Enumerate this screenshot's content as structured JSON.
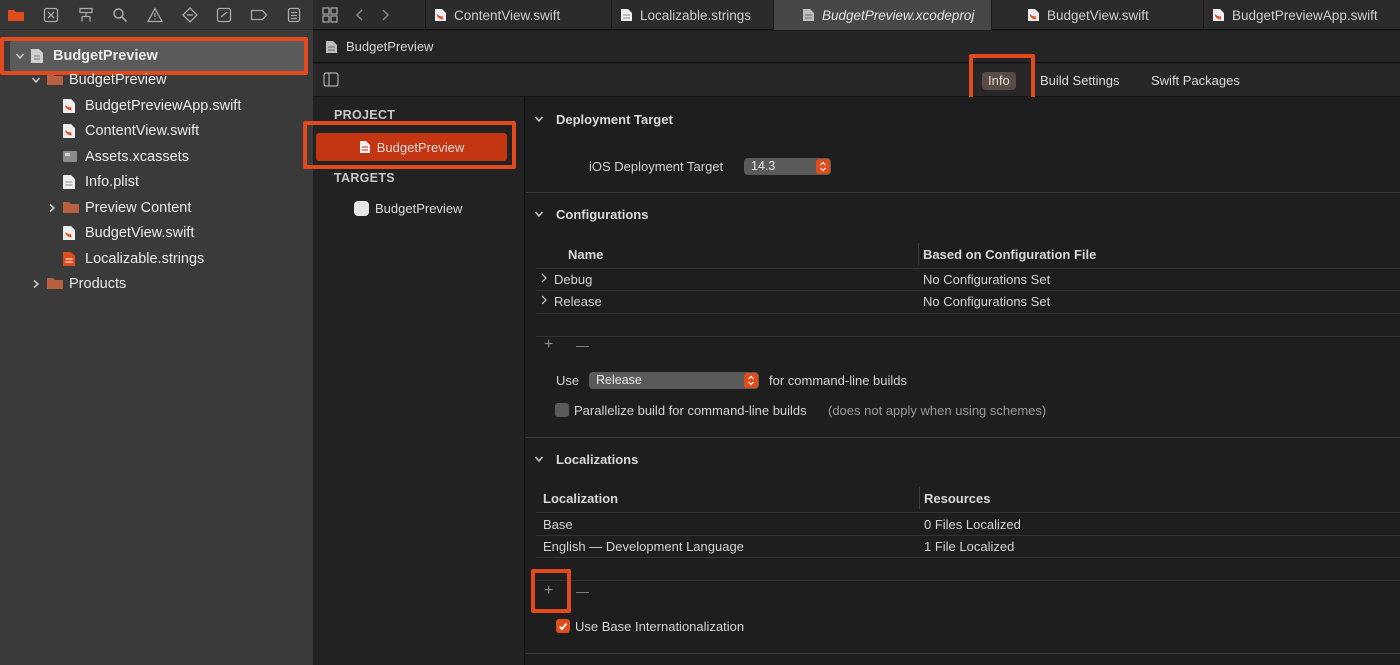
{
  "navigator": {
    "toolbar_icons": [
      "folder-icon",
      "source-control-icon",
      "hierarchy-icon",
      "find-icon",
      "issue-icon",
      "test-icon",
      "debug-icon",
      "breakpoint-icon",
      "report-icon"
    ],
    "tree": [
      {
        "label": "BudgetPreview",
        "level": 0,
        "kind": "project",
        "expanded": true
      },
      {
        "label": "BudgetPreview",
        "level": 1,
        "kind": "group",
        "expanded": true
      },
      {
        "label": "BudgetPreviewApp.swift",
        "level": 2,
        "kind": "swift"
      },
      {
        "label": "ContentView.swift",
        "level": 2,
        "kind": "swift"
      },
      {
        "label": "Assets.xcassets",
        "level": 2,
        "kind": "assets"
      },
      {
        "label": "Info.plist",
        "level": 2,
        "kind": "plist"
      },
      {
        "label": "Preview Content",
        "level": 2,
        "kind": "group",
        "expanded": false
      },
      {
        "label": "BudgetView.swift",
        "level": 2,
        "kind": "swift"
      },
      {
        "label": "Localizable.strings",
        "level": 2,
        "kind": "strings"
      },
      {
        "label": "Products",
        "level": 1,
        "kind": "group",
        "expanded": false
      }
    ]
  },
  "tabs": [
    {
      "label": "ContentView.swift",
      "active": false
    },
    {
      "label": "Localizable.strings",
      "active": false
    },
    {
      "label": "BudgetPreview.xcodeproj",
      "active": true
    },
    {
      "label": "BudgetView.swift",
      "active": false
    },
    {
      "label": "BudgetPreviewApp.swift",
      "active": false
    }
  ],
  "jumpbar": {
    "label": "BudgetPreview"
  },
  "segments": {
    "info": "Info",
    "build_settings": "Build Settings",
    "swift_packages": "Swift Packages",
    "selected": "Info"
  },
  "project_list": {
    "project_header": "PROJECT",
    "project_item": "BudgetPreview",
    "targets_header": "TARGETS",
    "target_item": "BudgetPreview"
  },
  "deployment": {
    "title": "Deployment Target",
    "ios_label": "iOS Deployment Target",
    "ios_value": "14.3"
  },
  "configurations": {
    "title": "Configurations",
    "col_name": "Name",
    "col_file": "Based on Configuration File",
    "rows": [
      {
        "name": "Debug",
        "file": "No Configurations Set"
      },
      {
        "name": "Release",
        "file": "No Configurations Set"
      }
    ],
    "use_label": "Use",
    "use_value": "Release",
    "use_suffix": "for command-line builds",
    "parallelize_label": "Parallelize build for command-line builds",
    "parallelize_note": "(does not apply when using schemes)",
    "parallelize_checked": false
  },
  "localizations": {
    "title": "Localizations",
    "col_loc": "Localization",
    "col_res": "Resources",
    "rows": [
      {
        "name": "Base",
        "resources": "0 Files Localized"
      },
      {
        "name": "English — Development Language",
        "resources": "1 File Localized"
      }
    ],
    "base_intl_label": "Use Base Internationalization",
    "base_intl_checked": true
  },
  "controls": {
    "plus": "+",
    "minus": "—"
  },
  "colors": {
    "accent": "#e04d1c",
    "highlight": "#e24a1e",
    "selected_row": "#c43612"
  }
}
